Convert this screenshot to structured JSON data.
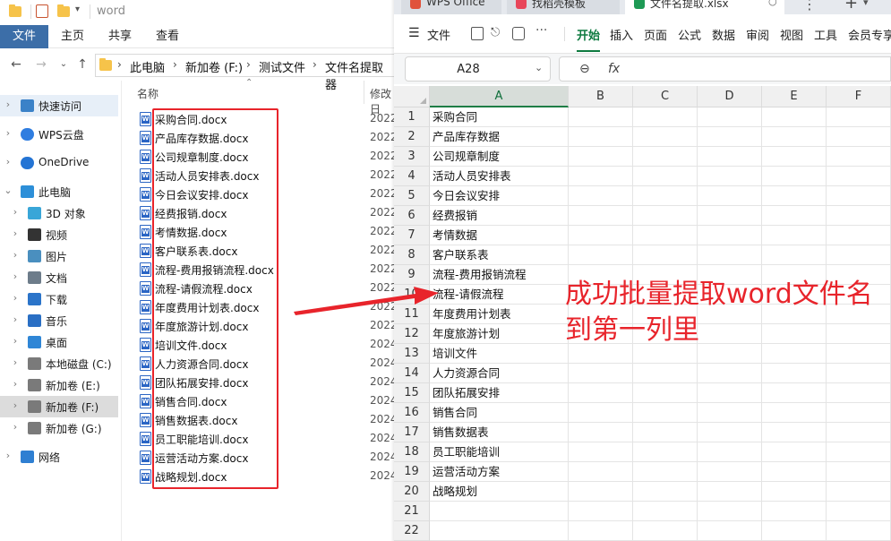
{
  "explorer": {
    "window_title": "word",
    "ribbon_tabs": [
      "文件",
      "主页",
      "共享",
      "查看"
    ],
    "breadcrumb": [
      "此电脑",
      "新加卷 (F:)",
      "测试文件",
      "文件名提取器"
    ],
    "nav": [
      {
        "label": "快速访问",
        "icon": "star-icon",
        "state": "selected"
      },
      {
        "label": "WPS云盘",
        "icon": "cloud-icon"
      },
      {
        "label": "OneDrive",
        "icon": "onedrive-icon"
      },
      {
        "label": "此电脑",
        "icon": "computer-icon",
        "expanded": true
      },
      {
        "label": "3D 对象",
        "icon": "cube-icon"
      },
      {
        "label": "视频",
        "icon": "video-icon"
      },
      {
        "label": "图片",
        "icon": "picture-icon"
      },
      {
        "label": "文档",
        "icon": "document-icon"
      },
      {
        "label": "下载",
        "icon": "download-icon"
      },
      {
        "label": "音乐",
        "icon": "music-icon"
      },
      {
        "label": "桌面",
        "icon": "desktop-icon"
      },
      {
        "label": "本地磁盘 (C:)",
        "icon": "drive-icon"
      },
      {
        "label": "新加卷 (E:)",
        "icon": "drive-icon"
      },
      {
        "label": "新加卷 (F:)",
        "icon": "drive-icon",
        "state": "current"
      },
      {
        "label": "新加卷 (G:)",
        "icon": "drive-icon"
      },
      {
        "label": "网络",
        "icon": "network-icon"
      }
    ],
    "columns": {
      "name": "名称",
      "modified": "修改日"
    },
    "files": [
      {
        "name": "采购合同.docx",
        "date": "2022"
      },
      {
        "name": "产品库存数据.docx",
        "date": "2022"
      },
      {
        "name": "公司规章制度.docx",
        "date": "2022"
      },
      {
        "name": "活动人员安排表.docx",
        "date": "2022"
      },
      {
        "name": "今日会议安排.docx",
        "date": "2022"
      },
      {
        "name": "经费报销.docx",
        "date": "2022"
      },
      {
        "name": "考情数据.docx",
        "date": "2022"
      },
      {
        "name": "客户联系表.docx",
        "date": "2022"
      },
      {
        "name": "流程-费用报销流程.docx",
        "date": "2022"
      },
      {
        "name": "流程-请假流程.docx",
        "date": "2022"
      },
      {
        "name": "年度费用计划表.docx",
        "date": "2022"
      },
      {
        "name": "年度旅游计划.docx",
        "date": "2022"
      },
      {
        "name": "培训文件.docx",
        "date": "2024"
      },
      {
        "name": "人力资源合同.docx",
        "date": "2024"
      },
      {
        "name": "团队拓展安排.docx",
        "date": "2024"
      },
      {
        "name": "销售合同.docx",
        "date": "2024"
      },
      {
        "name": "销售数据表.docx",
        "date": "2024"
      },
      {
        "name": "员工职能培训.docx",
        "date": "2024"
      },
      {
        "name": "运营活动方案.docx",
        "date": "2024"
      },
      {
        "name": "战略规划.docx",
        "date": "2024"
      }
    ]
  },
  "wps": {
    "tabs": [
      "WPS Office",
      "找稻壳模板",
      "文件名提取.xlsx"
    ],
    "menus": [
      "文件",
      "开始",
      "插入",
      "页面",
      "公式",
      "数据",
      "审阅",
      "视图",
      "工具",
      "会员专享"
    ],
    "active_menu": "开始",
    "name_box": "A28",
    "formula_icons": [
      "zoom-icon",
      "fx-icon"
    ],
    "columns": [
      "A",
      "B",
      "C",
      "D",
      "E",
      "F"
    ],
    "rows": [
      {
        "n": "1",
        "a": "采购合同"
      },
      {
        "n": "2",
        "a": "产品库存数据"
      },
      {
        "n": "3",
        "a": "公司规章制度"
      },
      {
        "n": "4",
        "a": "活动人员安排表"
      },
      {
        "n": "5",
        "a": "今日会议安排"
      },
      {
        "n": "6",
        "a": "经费报销"
      },
      {
        "n": "7",
        "a": "考情数据"
      },
      {
        "n": "8",
        "a": "客户联系表"
      },
      {
        "n": "9",
        "a": "流程-费用报销流程"
      },
      {
        "n": "10",
        "a": "流程-请假流程"
      },
      {
        "n": "11",
        "a": "年度费用计划表"
      },
      {
        "n": "12",
        "a": "年度旅游计划"
      },
      {
        "n": "13",
        "a": "培训文件"
      },
      {
        "n": "14",
        "a": "人力资源合同"
      },
      {
        "n": "15",
        "a": "团队拓展安排"
      },
      {
        "n": "16",
        "a": "销售合同"
      },
      {
        "n": "17",
        "a": "销售数据表"
      },
      {
        "n": "18",
        "a": "员工职能培训"
      },
      {
        "n": "19",
        "a": "运营活动方案"
      },
      {
        "n": "20",
        "a": "战略规划"
      },
      {
        "n": "21",
        "a": ""
      },
      {
        "n": "22",
        "a": ""
      }
    ]
  },
  "annotation": {
    "line1": "成功批量提取word文件名",
    "line2": "到第一列里",
    "color": "#e8242b"
  }
}
